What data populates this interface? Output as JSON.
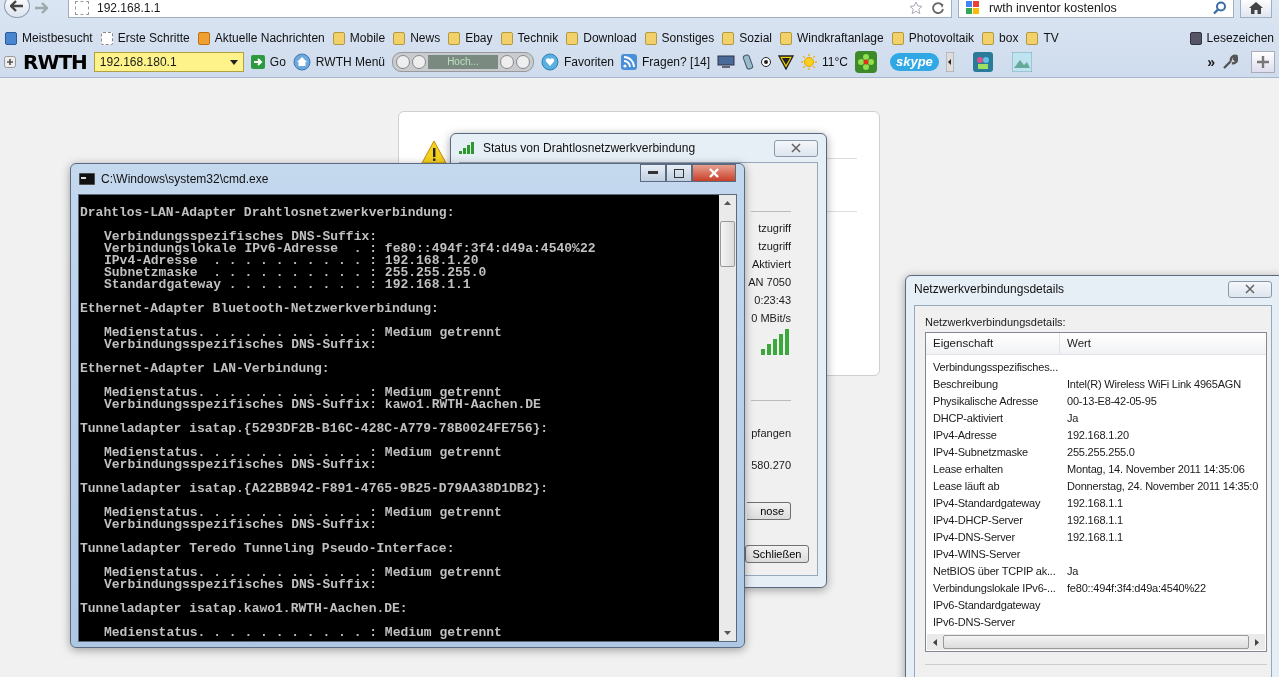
{
  "browser": {
    "nav": {
      "url": "192.168.1.1",
      "search": "rwth inventor kostenlos"
    },
    "bookmarks": [
      {
        "label": "Meistbesucht",
        "kind": "special"
      },
      {
        "label": "Erste Schritte",
        "kind": "page"
      },
      {
        "label": "Aktuelle Nachrichten",
        "kind": "feed"
      },
      {
        "label": "Mobile",
        "kind": "folder"
      },
      {
        "label": "News",
        "kind": "folder"
      },
      {
        "label": "Ebay",
        "kind": "folder"
      },
      {
        "label": "Technik",
        "kind": "folder"
      },
      {
        "label": "Download",
        "kind": "folder"
      },
      {
        "label": "Sonstiges",
        "kind": "folder"
      },
      {
        "label": "Sozial",
        "kind": "folder"
      },
      {
        "label": "Windkraftanlage",
        "kind": "folder"
      },
      {
        "label": "Photovoltaik",
        "kind": "folder"
      },
      {
        "label": "box",
        "kind": "folder"
      },
      {
        "label": "TV",
        "kind": "folder"
      }
    ],
    "bookmarks_menu": "Lesezeichen",
    "toolbar": {
      "logo": "RWTH",
      "address": "192.168.180.1",
      "go": "Go",
      "menu": "RWTH Menü",
      "player": "Hoch...",
      "favorites": "Favoriten",
      "questions": "Fragen? [14]",
      "weather": "11°C",
      "skype": "skype",
      "overflow": "»"
    }
  },
  "status_window": {
    "title": "Status von Drahtlosnetzwerkverbindung",
    "values": [
      "tzugriff",
      "tzugriff",
      "Aktiviert",
      "AN 7050",
      "0:23:43",
      "0 MBit/s"
    ],
    "activity_label": "pfangen",
    "activity_value": "580.270",
    "buttons": [
      "nose",
      "Schließen"
    ]
  },
  "cmd_window": {
    "title": "C:\\Windows\\system32\\cmd.exe",
    "sections": [
      {
        "heading": "Drahtlos-LAN-Adapter Drahtlosnetzwerkverbindung:",
        "lines": [
          "Verbindungsspezifisches DNS-Suffix:",
          "Verbindungslokale IPv6-Adresse  . : fe80::494f:3f4:d49a:4540%22",
          "IPv4-Adresse  . . . . . . . . . . : 192.168.1.20",
          "Subnetzmaske  . . . . . . . . . . : 255.255.255.0",
          "Standardgateway . . . . . . . . . : 192.168.1.1"
        ]
      },
      {
        "heading": "Ethernet-Adapter Bluetooth-Netzwerkverbindung:",
        "lines": [
          "Medienstatus. . . . . . . . . . . : Medium getrennt",
          "Verbindungsspezifisches DNS-Suffix:"
        ]
      },
      {
        "heading": "Ethernet-Adapter LAN-Verbindung:",
        "lines": [
          "Medienstatus. . . . . . . . . . . : Medium getrennt",
          "Verbindungsspezifisches DNS-Suffix: kawo1.RWTH-Aachen.DE"
        ]
      },
      {
        "heading": "Tunneladapter isatap.{5293DF2B-B16C-428C-A779-78B0024FE756}:",
        "lines": [
          "Medienstatus. . . . . . . . . . . : Medium getrennt",
          "Verbindungsspezifisches DNS-Suffix:"
        ]
      },
      {
        "heading": "Tunneladapter isatap.{A22BB942-F891-4765-9B25-D79AA38D1DB2}:",
        "lines": [
          "Medienstatus. . . . . . . . . . . : Medium getrennt",
          "Verbindungsspezifisches DNS-Suffix:"
        ]
      },
      {
        "heading": "Tunneladapter Teredo Tunneling Pseudo-Interface:",
        "lines": [
          "Medienstatus. . . . . . . . . . . : Medium getrennt",
          "Verbindungsspezifisches DNS-Suffix:"
        ]
      },
      {
        "heading": "Tunneladapter isatap.kawo1.RWTH-Aachen.DE:",
        "lines": [
          "Medienstatus. . . . . . . . . . . : Medium getrennt"
        ]
      }
    ]
  },
  "details_window": {
    "title": "Netzwerkverbindungsdetails",
    "caption": "Netzwerkverbindungsdetails:",
    "columns": [
      "Eigenschaft",
      "Wert"
    ],
    "rows": [
      {
        "property": "Verbindungsspezifisches..."
      },
      {
        "property": "Beschreibung",
        "value": "Intel(R) Wireless WiFi Link 4965AGN"
      },
      {
        "property": "Physikalische Adresse",
        "value": "00-13-E8-42-05-95"
      },
      {
        "property": "DHCP-aktiviert",
        "value": "Ja"
      },
      {
        "property": "IPv4-Adresse",
        "value": "192.168.1.20"
      },
      {
        "property": "IPv4-Subnetzmaske",
        "value": "255.255.255.0"
      },
      {
        "property": "Lease erhalten",
        "value": "Montag, 14. November 2011 14:35:06"
      },
      {
        "property": "Lease läuft ab",
        "value": "Donnerstag, 24. November 2011 14:35:0"
      },
      {
        "property": "IPv4-Standardgateway",
        "value": "192.168.1.1"
      },
      {
        "property": "IPv4-DHCP-Server",
        "value": "192.168.1.1"
      },
      {
        "property": "IPv4-DNS-Server",
        "value": "192.168.1.1"
      },
      {
        "property": "IPv4-WINS-Server"
      },
      {
        "property": "NetBIOS über TCPIP ak...",
        "value": "Ja"
      },
      {
        "property": "Verbindungslokale IPv6-...",
        "value": "fe80::494f:3f4:d49a:4540%22"
      },
      {
        "property": "IPv6-Standardgateway"
      },
      {
        "property": "IPv6-DNS-Server"
      }
    ]
  }
}
